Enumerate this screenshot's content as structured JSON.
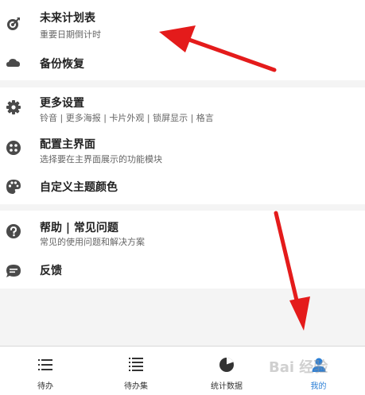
{
  "menu": {
    "group1": [
      {
        "title": "未来计划表",
        "subtitle": "重要日期倒计时",
        "icon": "target-icon"
      },
      {
        "title": "备份恢复",
        "subtitle": "",
        "icon": "cloud-icon"
      }
    ],
    "group2": [
      {
        "title": "更多设置",
        "subtitle": "铃音 | 更多海报 | 卡片外观 | 锁屏显示 | 格言",
        "icon": "gear-icon"
      },
      {
        "title": "配置主界面",
        "subtitle": "选择要在主界面展示的功能模块",
        "icon": "grid-icon"
      },
      {
        "title": "自定义主题颜色",
        "subtitle": "",
        "icon": "palette-icon"
      }
    ],
    "group3": [
      {
        "title": "帮助 | 常见问题",
        "subtitle": "常见的使用问题和解决方案",
        "icon": "help-icon"
      },
      {
        "title": "反馈",
        "subtitle": "",
        "icon": "chat-icon"
      }
    ]
  },
  "tabbar": {
    "tabs": [
      {
        "label": "待办",
        "icon": "list-icon"
      },
      {
        "label": "待办集",
        "icon": "list-collection-icon"
      },
      {
        "label": "统计数据",
        "icon": "pie-chart-icon"
      },
      {
        "label": "我的",
        "icon": "person-icon"
      }
    ],
    "active_index": 3
  },
  "watermark": "Bai 经验",
  "colors": {
    "accent": "#2b7fd6",
    "icon": "#4a4a4a",
    "arrow": "#e41b1b",
    "background": "#f4f4f4"
  }
}
